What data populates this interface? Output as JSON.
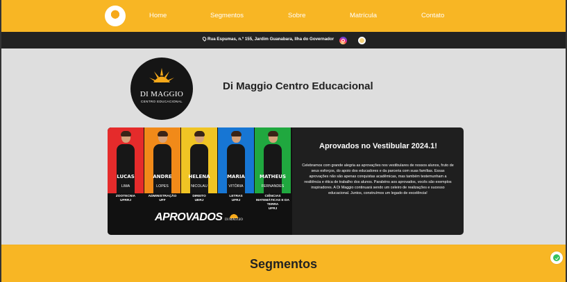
{
  "nav": {
    "items": [
      "Home",
      "Segmentos",
      "Sobre",
      "Matrícula",
      "Contato"
    ]
  },
  "contact": {
    "address": "Rua Espumas, n.º 155, Jardim Guanabara, Ilha do Governador"
  },
  "brand": {
    "name": "DI MAGGIO",
    "tagline": "CENTRO EDUCACIONAL",
    "title": "Di Maggio Centro Educacional"
  },
  "promo": {
    "students": [
      {
        "first": "LUCAS",
        "last": "LIMA",
        "course": "ZOOTECNIA",
        "school": "UFRRJ",
        "color": "#e52b2b"
      },
      {
        "first": "ANDRE",
        "last": "LOPES",
        "course": "ADMINISTRAÇÃO",
        "school": "UFF",
        "color": "#f18a19"
      },
      {
        "first": "HELENA",
        "last": "NICOLAU",
        "course": "DIREITO",
        "school": "UERJ",
        "color": "#f0c424"
      },
      {
        "first": "MARIA",
        "last": "VITÓRIA",
        "course": "LETRAS",
        "school": "UFRJ",
        "color": "#1776d4"
      },
      {
        "first": "MATHEUS",
        "last": "FERNANDES",
        "course": "CIÊNCIAS MATEMÁTICAS E DA TERRA",
        "school": "UFRJ",
        "color": "#20a83f"
      }
    ],
    "banner": "APROVADOS",
    "logo_text": "DI MAGGIO"
  },
  "announcement": {
    "title": "Aprovados no Vestibular 2024.1!",
    "text": "Celebramos com grande alegria as aprovações nos vestibulares de nossos alunos, fruto de seus esforços, do apoio dos educadores e da parceria com suas famílias. Essas aprovações não são apenas conquistas acadêmicas, mas também testemunham a resiliência e ética de trabalho dos alunos. Parabéns aos aprovados, vocês são exemplos inspiradores. A Di Maggio continuará sendo um celeiro de realizações e sucesso educacional. Juntos, construímos um legado de excelência!"
  },
  "section": {
    "title": "Segmentos"
  }
}
